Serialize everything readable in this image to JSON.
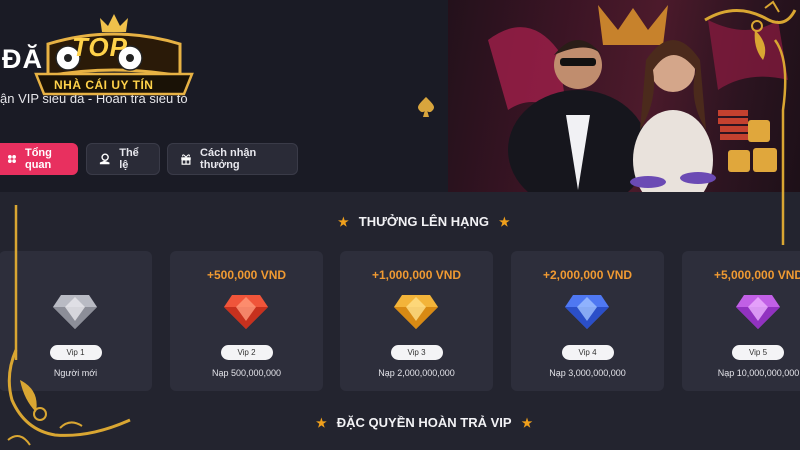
{
  "hero": {
    "title": "ĐĂ          VIP",
    "subtitle": "ận VIP siêu đã - Hoàn trả siêu to"
  },
  "logo": {
    "line1": "TOP",
    "line2": "NHÀ CÁI UY TÍN"
  },
  "tabs": [
    {
      "label": "Tổng quan",
      "active": true,
      "icon": "grid-icon"
    },
    {
      "label": "Thể lệ",
      "active": false,
      "icon": "gear-hand-icon"
    },
    {
      "label": "Cách nhận thưởng",
      "active": false,
      "icon": "gift-icon"
    }
  ],
  "sections": {
    "rank_rewards": "THƯỞNG LÊN HẠNG",
    "cashback": "ĐẶC QUYỀN HOÀN TRẢ VIP"
  },
  "vip_levels": [
    {
      "reward": "",
      "badge": "Vip 1",
      "requirement": "Người mới",
      "gem_color": "#b9bbc4"
    },
    {
      "reward": "+500,000 VND",
      "badge": "Vip 2",
      "requirement": "Nạp 500,000,000",
      "gem_color": "#f0553a"
    },
    {
      "reward": "+1,000,000 VND",
      "badge": "Vip 3",
      "requirement": "Nạp 2,000,000,000",
      "gem_color": "#f3b43a"
    },
    {
      "reward": "+2,000,000 VND",
      "badge": "Vip 4",
      "requirement": "Nạp 3,000,000,000",
      "gem_color": "#4f78f2"
    },
    {
      "reward": "+5,000,000 VND",
      "badge": "Vip 5",
      "requirement": "Nạp 10,000,000,000",
      "gem_color": "#c160e6"
    }
  ],
  "colors": {
    "accent": "#e8305f",
    "reward_text": "#f09a32",
    "star": "#f0a01c",
    "gold_frame": "#d9a632"
  }
}
